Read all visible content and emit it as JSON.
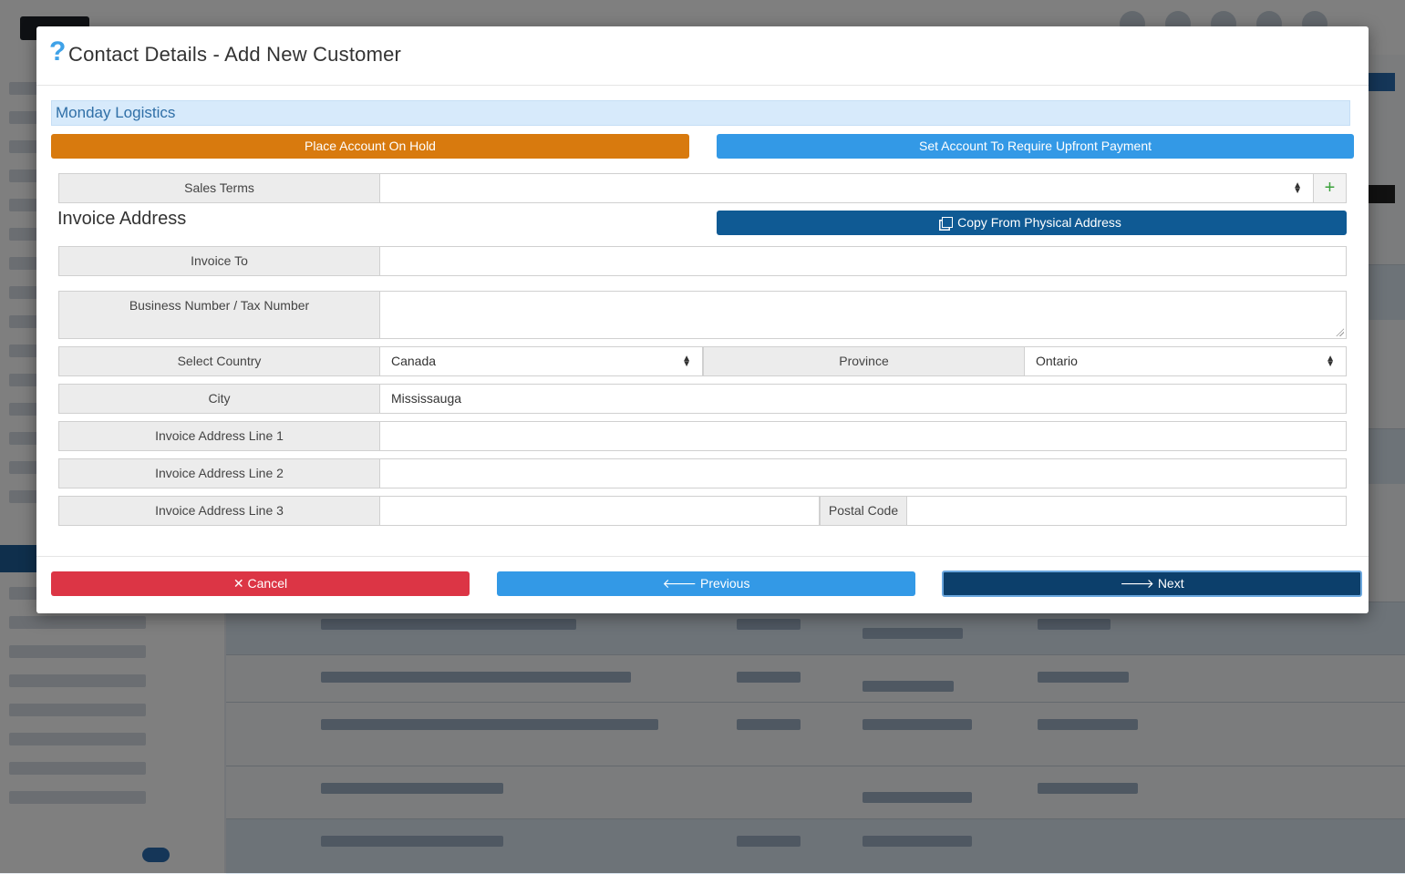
{
  "modal": {
    "help_icon": "?",
    "title": "Contact Details - Add New Customer",
    "company_name": "Monday Logistics",
    "place_on_hold_label": "Place Account On Hold",
    "require_upfront_label": "Set Account To Require Upfront Payment",
    "sales_terms": {
      "label": "Sales Terms",
      "value": ""
    },
    "add_icon": "+",
    "invoice_section_title": "Invoice Address",
    "copy_address_label": "Copy From Physical Address",
    "fields": {
      "invoice_to": {
        "label": "Invoice To",
        "value": ""
      },
      "business_number": {
        "label": "Business Number / Tax Number",
        "value": ""
      },
      "country": {
        "label": "Select Country",
        "value": "Canada"
      },
      "province": {
        "label": "Province",
        "value": "Ontario"
      },
      "city": {
        "label": "City",
        "value": "Mississauga"
      },
      "line1": {
        "label": "Invoice Address Line 1",
        "value": ""
      },
      "line2": {
        "label": "Invoice Address Line 2",
        "value": ""
      },
      "line3": {
        "label": "Invoice Address Line 3",
        "value": ""
      },
      "postal_code": {
        "label": "Postal Code",
        "value": ""
      }
    },
    "footer": {
      "cancel_label": "✕ Cancel",
      "previous_label": "🡐 Previous",
      "next_label": "🡒 Next"
    }
  },
  "colors": {
    "hold": "#d87a0e",
    "upfront": "#3399e6",
    "copy": "#0f5a94",
    "cancel": "#dc3545",
    "previous": "#3399e6",
    "next": "#0c3f6b",
    "company_bar": "#d7eafb"
  },
  "icons": {
    "help": "question-mark-icon",
    "add": "plus-icon",
    "copy": "copy-icon",
    "select": "sort-arrows-icon",
    "cancel": "close-icon",
    "previous": "arrow-left-icon",
    "next": "arrow-right-icon"
  }
}
